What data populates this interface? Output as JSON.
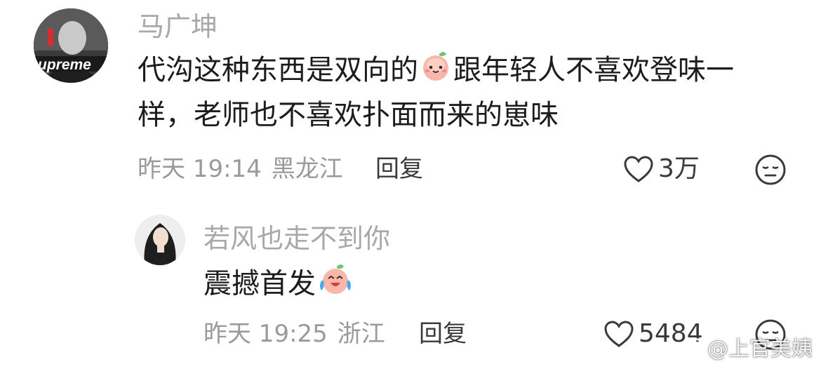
{
  "comments": [
    {
      "username": "马广坤",
      "avatar_text": "upreme",
      "text_part1": "代沟这种东西是双向的",
      "text_part2": "跟年轻人不喜欢登味一样，老师也不喜欢扑面而来的崽味",
      "emoji": "smile-peach-icon",
      "time": "昨天 19:14",
      "location": "黑龙江",
      "reply_label": "回复",
      "likes": "3万"
    },
    {
      "username": "若风也走不到你",
      "text_part1": "震撼首发",
      "emoji": "laugh-cry-peach-icon",
      "time": "昨天 19:25",
      "location": "浙江",
      "reply_label": "回复",
      "likes": "5484"
    }
  ],
  "watermark": "@上官美姨",
  "colors": {
    "username": "#a8a8a8",
    "text": "#1c1c1c",
    "meta": "#9a9a9a",
    "action": "#3a3a3a",
    "emoji_peach": "#f7b3a6"
  }
}
